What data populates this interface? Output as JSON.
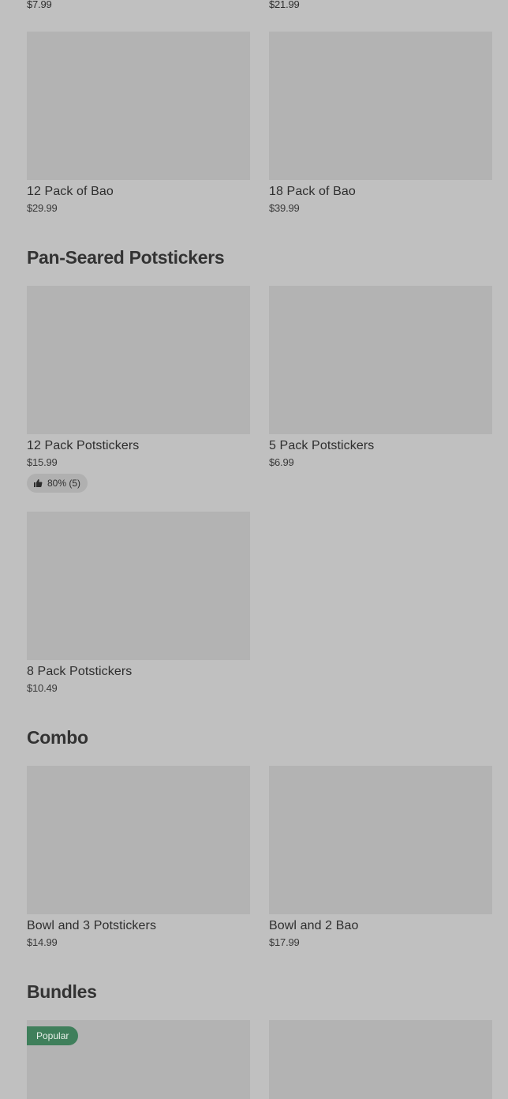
{
  "top_row": {
    "left_price": "$7.99",
    "right_price": "$21.99"
  },
  "bao_items": [
    {
      "name": "12 Pack of Bao",
      "price": "$29.99"
    },
    {
      "name": "18 Pack of Bao",
      "price": "$39.99"
    }
  ],
  "sections": {
    "potstickers": {
      "title": "Pan-Seared Potstickers",
      "items": [
        {
          "name": "12 Pack Potstickers",
          "price": "$15.99",
          "rating": "80% (5)"
        },
        {
          "name": "5 Pack Potstickers",
          "price": "$6.99"
        },
        {
          "name": "8 Pack Potstickers",
          "price": "$10.49"
        }
      ]
    },
    "combo": {
      "title": "Combo",
      "items": [
        {
          "name": "Bowl and 3 Potstickers",
          "price": "$14.99"
        },
        {
          "name": "Bowl and 2 Bao",
          "price": "$17.99"
        }
      ]
    },
    "bundles": {
      "title": "Bundles",
      "badge": "Popular"
    }
  },
  "icons": {
    "rating": "thumbs-up-icon"
  },
  "colors": {
    "background": "#c0c0c0",
    "thumbnail": "#b3b3b3",
    "badge": "#3f7f5b"
  }
}
